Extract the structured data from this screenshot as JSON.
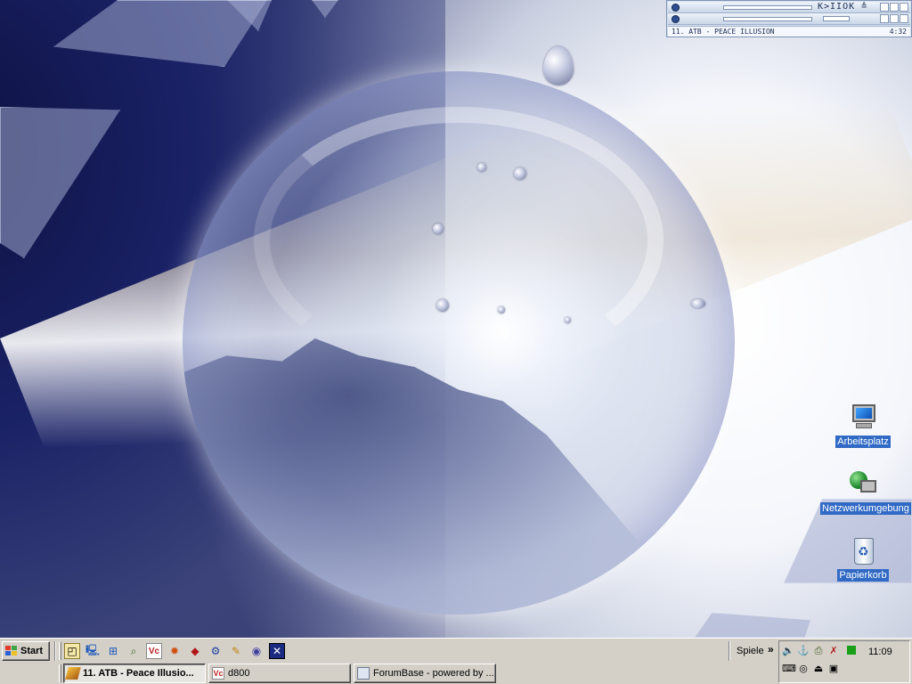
{
  "desktop": {
    "icons": [
      {
        "label": "Arbeitsplatz",
        "icon": "my-computer-icon"
      },
      {
        "label": "Netzwerkumgebung",
        "icon": "network-neighborhood-icon"
      },
      {
        "label": "Papierkorb",
        "icon": "recycle-bin-icon"
      }
    ]
  },
  "media_player": {
    "controls": "K>IIOK ≜",
    "track_title": "11. ATB - PEACE ILLUSION",
    "time": "4:32"
  },
  "taskbar": {
    "start_label": "Start",
    "quicklaunch": [
      "show-desktop-icon",
      "computer-icon",
      "network-icon",
      "search-icon",
      "vc-editor-icon",
      "fire-icon",
      "game-icon",
      "tool-icon",
      "feather-icon",
      "media-icon",
      "flag-icon"
    ],
    "tasks": [
      {
        "label": "11. ATB - Peace Illusio...",
        "icon": "winamp-icon",
        "active": true
      },
      {
        "label": "d800",
        "icon": "vc-editor-icon",
        "active": false
      },
      {
        "label": "ForumBase - powered by ...",
        "icon": "browser-icon",
        "active": false
      }
    ],
    "toolbar_label": "Spiele",
    "chevron": "»",
    "clock": "11:09"
  },
  "colors": {
    "taskbar": "#d4d0c8",
    "icon_label_bg": "#316ac5"
  }
}
